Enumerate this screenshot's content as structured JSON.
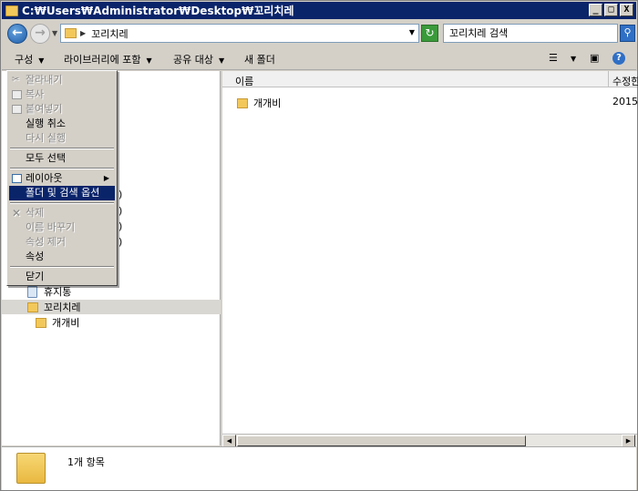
{
  "window": {
    "title": "C:₩Users₩Administrator₩Desktop₩꼬리치레",
    "minimize": "_",
    "maximize": "□",
    "close": "X"
  },
  "address": {
    "path": "꼬리치레",
    "search_placeholder": "꼬리치레 검색"
  },
  "toolbar": {
    "organize": "구성",
    "include_library": "라이브러리에 포함",
    "share_with": "공유 대상",
    "new_folder": "새 폴더"
  },
  "tree": {
    "peek_items": [
      ")",
      ")",
      ")",
      ")"
    ],
    "recycle_bin": "휴지통",
    "selected_folder": "꼬리치레",
    "subfolder": "개개비"
  },
  "files": {
    "column_name": "이름",
    "column_date": "수정한",
    "rows": [
      {
        "name": "개개비",
        "date": "2015-"
      }
    ]
  },
  "status": {
    "text": "1개 항목"
  },
  "menu": {
    "cut": "잘라내기",
    "copy": "복사",
    "paste": "붙여넣기",
    "undo": "실행 취소",
    "redo": "다시 실행",
    "select_all": "모두 선택",
    "layout": "레이아웃",
    "folder_options": "폴더 및 검색 옵션",
    "delete": "삭제",
    "rename": "이름 바꾸기",
    "remove_properties": "속성 제거",
    "properties": "속성",
    "close": "닫기"
  },
  "colors": {
    "title_bar": "#0a246a",
    "highlight": "#0a246a",
    "folder": "#f3c85b"
  }
}
